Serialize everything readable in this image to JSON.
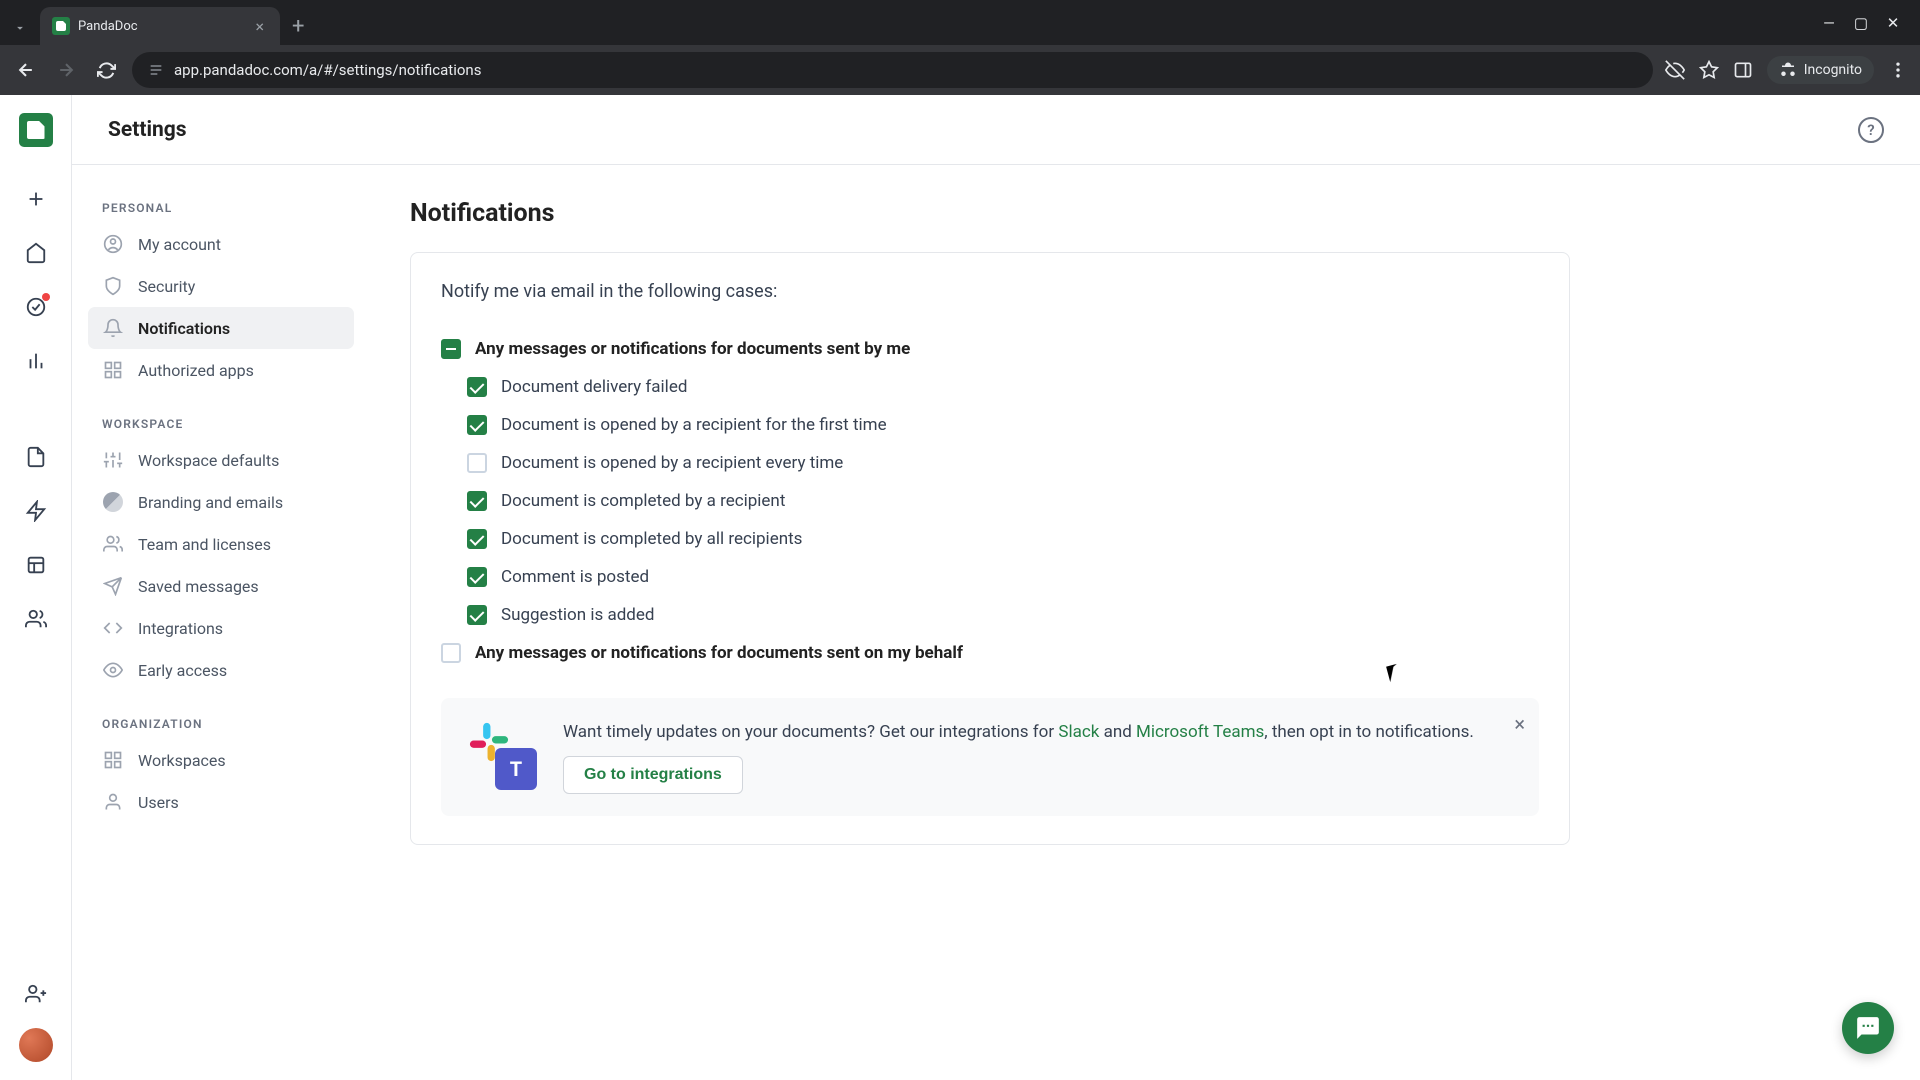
{
  "browser": {
    "tab_title": "PandaDoc",
    "url": "app.pandadoc.com/a/#/settings/notifications",
    "incognito_label": "Incognito"
  },
  "header": {
    "title": "Settings"
  },
  "nav": {
    "personal": {
      "heading": "PERSONAL",
      "items": [
        "My account",
        "Security",
        "Notifications",
        "Authorized apps"
      ]
    },
    "workspace": {
      "heading": "WORKSPACE",
      "items": [
        "Workspace defaults",
        "Branding and emails",
        "Team and licenses",
        "Saved messages",
        "Integrations",
        "Early access"
      ]
    },
    "organization": {
      "heading": "ORGANIZATION",
      "items": [
        "Workspaces",
        "Users"
      ]
    }
  },
  "main": {
    "title": "Notifications",
    "intro": "Notify me via email in the following cases:",
    "groups": [
      {
        "label": "Any messages or notifications for documents sent by me",
        "state": "indeterminate",
        "children": [
          {
            "label": "Document delivery failed",
            "checked": true
          },
          {
            "label": "Document is opened by a recipient for the first time",
            "checked": true
          },
          {
            "label": "Document is opened by a recipient every time",
            "checked": false
          },
          {
            "label": "Document is completed by a recipient",
            "checked": true
          },
          {
            "label": "Document is completed by all recipients",
            "checked": true
          },
          {
            "label": "Comment is posted",
            "checked": true
          },
          {
            "label": "Suggestion is added",
            "checked": true
          }
        ]
      },
      {
        "label": "Any messages or notifications for documents sent on my behalf",
        "state": "unchecked"
      }
    ],
    "promo": {
      "text_prefix": "Want timely updates on your documents? Get our integrations for ",
      "slack": "Slack",
      "text_mid": " and ",
      "teams": "Microsoft Teams",
      "text_suffix": ", then opt in to notifications.",
      "button": "Go to integrations"
    }
  }
}
